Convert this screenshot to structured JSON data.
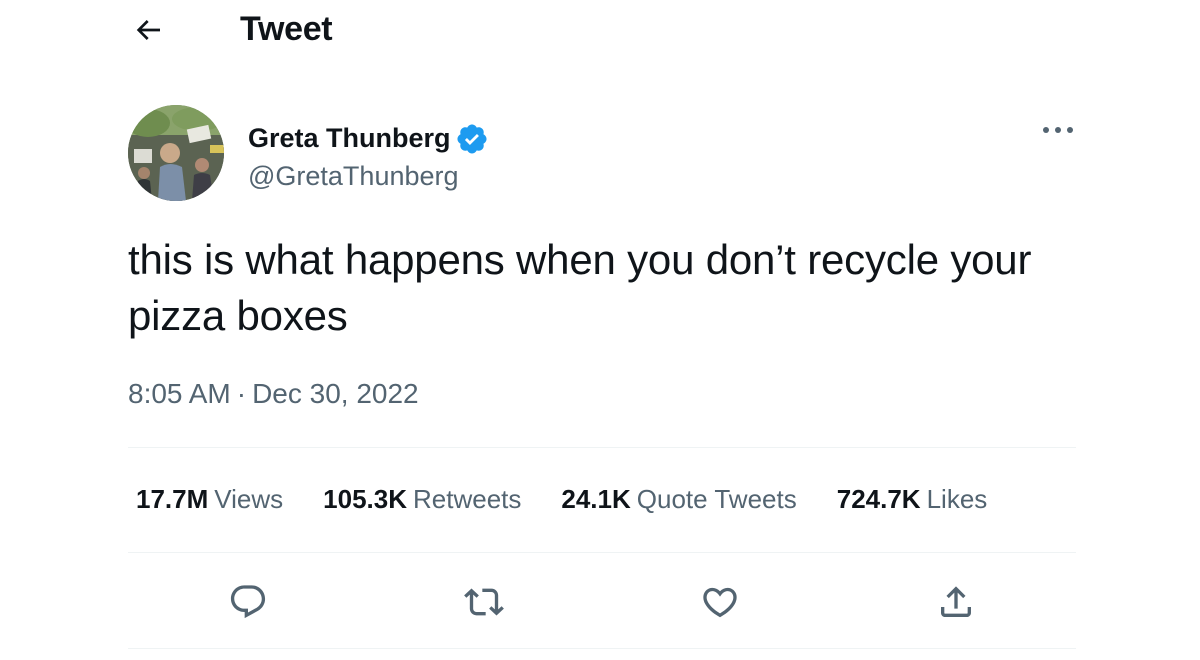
{
  "header": {
    "title": "Tweet",
    "back_icon": "arrow-left-icon"
  },
  "author": {
    "display_name": "Greta Thunberg",
    "handle": "@GretaThunberg",
    "verified": true,
    "verified_color": "#1d9bf0",
    "avatar_icon": "user-avatar"
  },
  "tweet": {
    "text": "this is what happens when you don’t recycle your pizza boxes",
    "time": "8:05 AM",
    "separator": "·",
    "date": "Dec 30, 2022"
  },
  "stats": [
    {
      "value": "17.7M",
      "label": "Views"
    },
    {
      "value": "105.3K",
      "label": "Retweets"
    },
    {
      "value": "24.1K",
      "label": "Quote Tweets"
    },
    {
      "value": "724.7K",
      "label": "Likes"
    }
  ],
  "actions": [
    {
      "name": "reply",
      "icon": "speech-bubble-icon"
    },
    {
      "name": "retweet",
      "icon": "retweet-arrows-icon"
    },
    {
      "name": "like",
      "icon": "heart-icon"
    },
    {
      "name": "share",
      "icon": "share-upload-icon"
    }
  ],
  "colors": {
    "text_primary": "#0f1419",
    "text_secondary": "#536471",
    "divider": "#eff3f4",
    "accent": "#1d9bf0"
  }
}
